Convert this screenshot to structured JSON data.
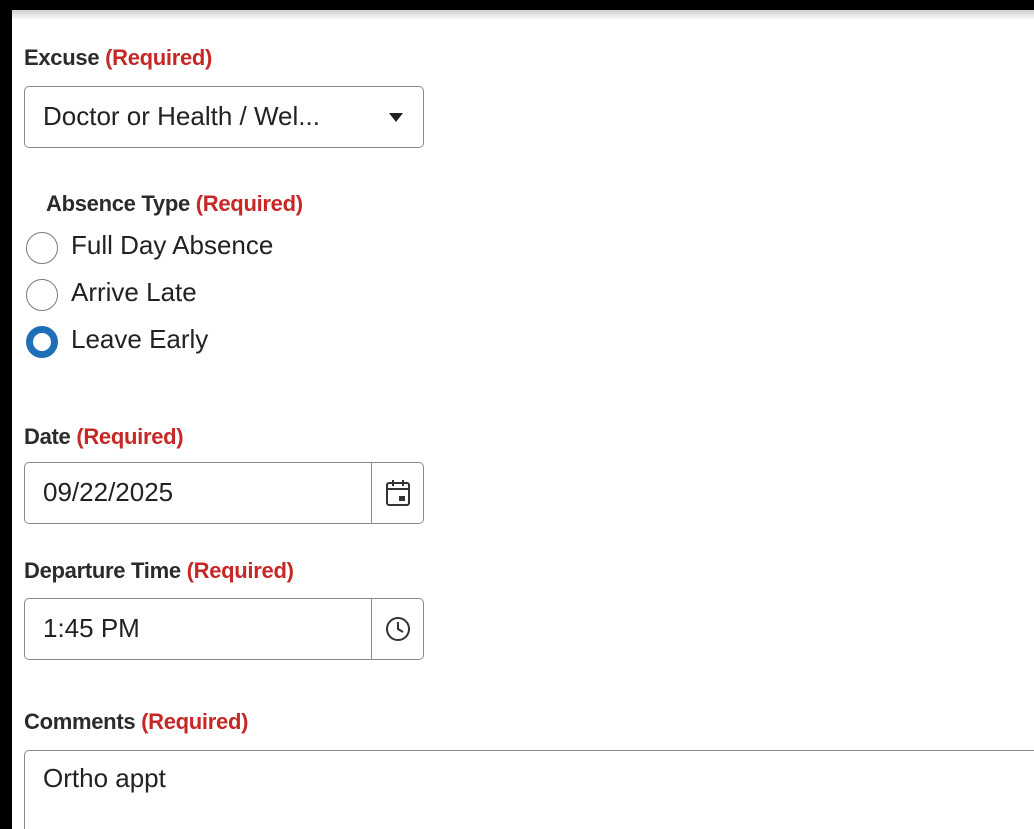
{
  "excuse": {
    "label": "Excuse",
    "required": "(Required)",
    "selected": "Doctor or Health / Wel..."
  },
  "absence_type": {
    "label": "Absence Type",
    "required": "(Required)",
    "options": [
      {
        "label": "Full Day Absence",
        "checked": false
      },
      {
        "label": "Arrive Late",
        "checked": false
      },
      {
        "label": "Leave Early",
        "checked": true
      }
    ]
  },
  "date": {
    "label": "Date",
    "required": "(Required)",
    "value": "09/22/2025",
    "icon": "calendar-icon"
  },
  "departure_time": {
    "label": "Departure Time",
    "required": "(Required)",
    "value": "1:45 PM",
    "icon": "clock-icon"
  },
  "comments": {
    "label": "Comments",
    "required": "(Required)",
    "value": "Ortho appt"
  },
  "colors": {
    "required_text": "#c62828",
    "radio_selected": "#1f6fb8",
    "border": "#8a8a8a"
  }
}
